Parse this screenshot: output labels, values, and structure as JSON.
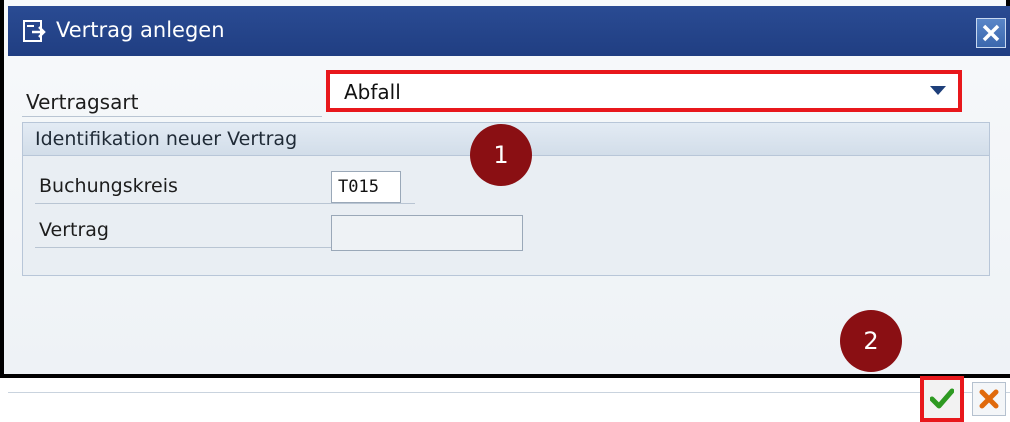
{
  "window": {
    "title": "Vertrag anlegen",
    "title_icon": "create-document-icon",
    "close_icon": "close-icon"
  },
  "form": {
    "vertragsart_label": "Vertragsart",
    "vertragsart_value": "Abfall",
    "group_title": "Identifikation neuer Vertrag",
    "buchungskreis_label": "Buchungskreis",
    "buchungskreis_value": "T015",
    "vertrag_label": "Vertrag",
    "vertrag_value": ""
  },
  "annotations": [
    {
      "number": "1"
    },
    {
      "number": "2"
    }
  ],
  "footer": {
    "ok_icon": "checkmark-icon",
    "cancel_icon": "cancel-icon"
  },
  "colors": {
    "titlebar": "#203e82",
    "highlight": "#e8181c",
    "badge": "#8a0f13",
    "ok_green": "#2e9a22",
    "cancel_orange": "#e06a0c"
  }
}
